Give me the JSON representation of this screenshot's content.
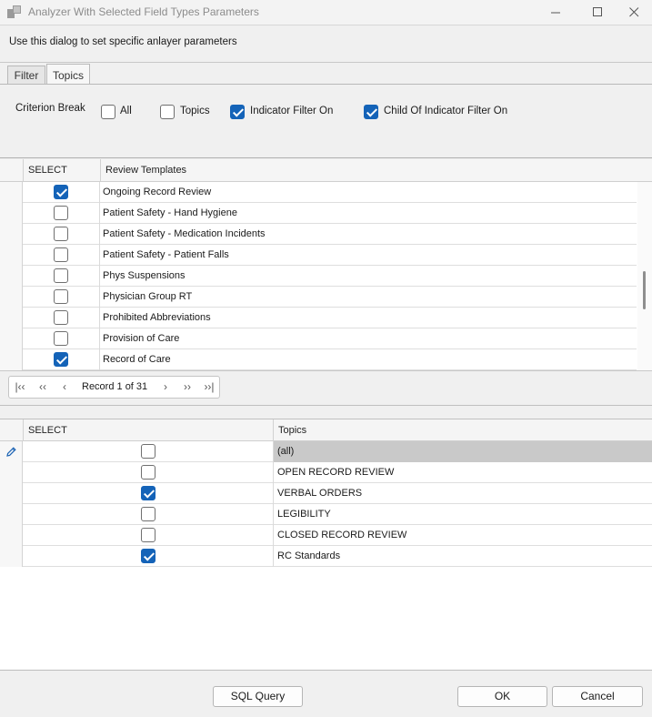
{
  "window": {
    "title": "Analyzer With Selected Field Types Parameters"
  },
  "description": "Use this dialog to set specific anlayer parameters",
  "tabs": [
    {
      "label": "Filter",
      "active": false
    },
    {
      "label": "Topics",
      "active": true
    }
  ],
  "criterion": {
    "label": "Criterion Break",
    "options": [
      {
        "label": "All",
        "checked": false
      },
      {
        "label": "Topics",
        "checked": false
      },
      {
        "label": "Indicator Filter On",
        "checked": true
      },
      {
        "label": "Child Of Indicator Filter On",
        "checked": true
      }
    ]
  },
  "templates_grid": {
    "columns": [
      "SELECT",
      "Review Templates"
    ],
    "rows": [
      {
        "checked": true,
        "name": "Ongoing Record Review"
      },
      {
        "checked": false,
        "name": "Patient Safety - Hand Hygiene"
      },
      {
        "checked": false,
        "name": "Patient Safety - Medication Incidents"
      },
      {
        "checked": false,
        "name": "Patient Safety - Patient Falls"
      },
      {
        "checked": false,
        "name": "Phys Suspensions"
      },
      {
        "checked": false,
        "name": "Physician Group RT"
      },
      {
        "checked": false,
        "name": "Prohibited Abbreviations"
      },
      {
        "checked": false,
        "name": "Provision of Care"
      },
      {
        "checked": true,
        "name": "Record of Care"
      }
    ]
  },
  "navigator": {
    "record_text": "Record 1 of 31",
    "buttons": [
      "first",
      "prev-page",
      "prev",
      "next",
      "next-page",
      "last"
    ]
  },
  "topics_grid": {
    "columns": [
      "SELECT",
      "Topics"
    ],
    "rows": [
      {
        "checked": false,
        "name": "(all)",
        "highlight": true
      },
      {
        "checked": false,
        "name": "OPEN RECORD REVIEW"
      },
      {
        "checked": true,
        "name": "VERBAL ORDERS"
      },
      {
        "checked": false,
        "name": "LEGIBILITY"
      },
      {
        "checked": false,
        "name": "CLOSED RECORD REVIEW"
      },
      {
        "checked": true,
        "name": "RC Standards"
      }
    ]
  },
  "buttons": {
    "sql": "SQL Query",
    "ok": "OK",
    "cancel": "Cancel"
  },
  "colors": {
    "accent": "#1463b8",
    "highlight_row": "#c9c9c9"
  }
}
